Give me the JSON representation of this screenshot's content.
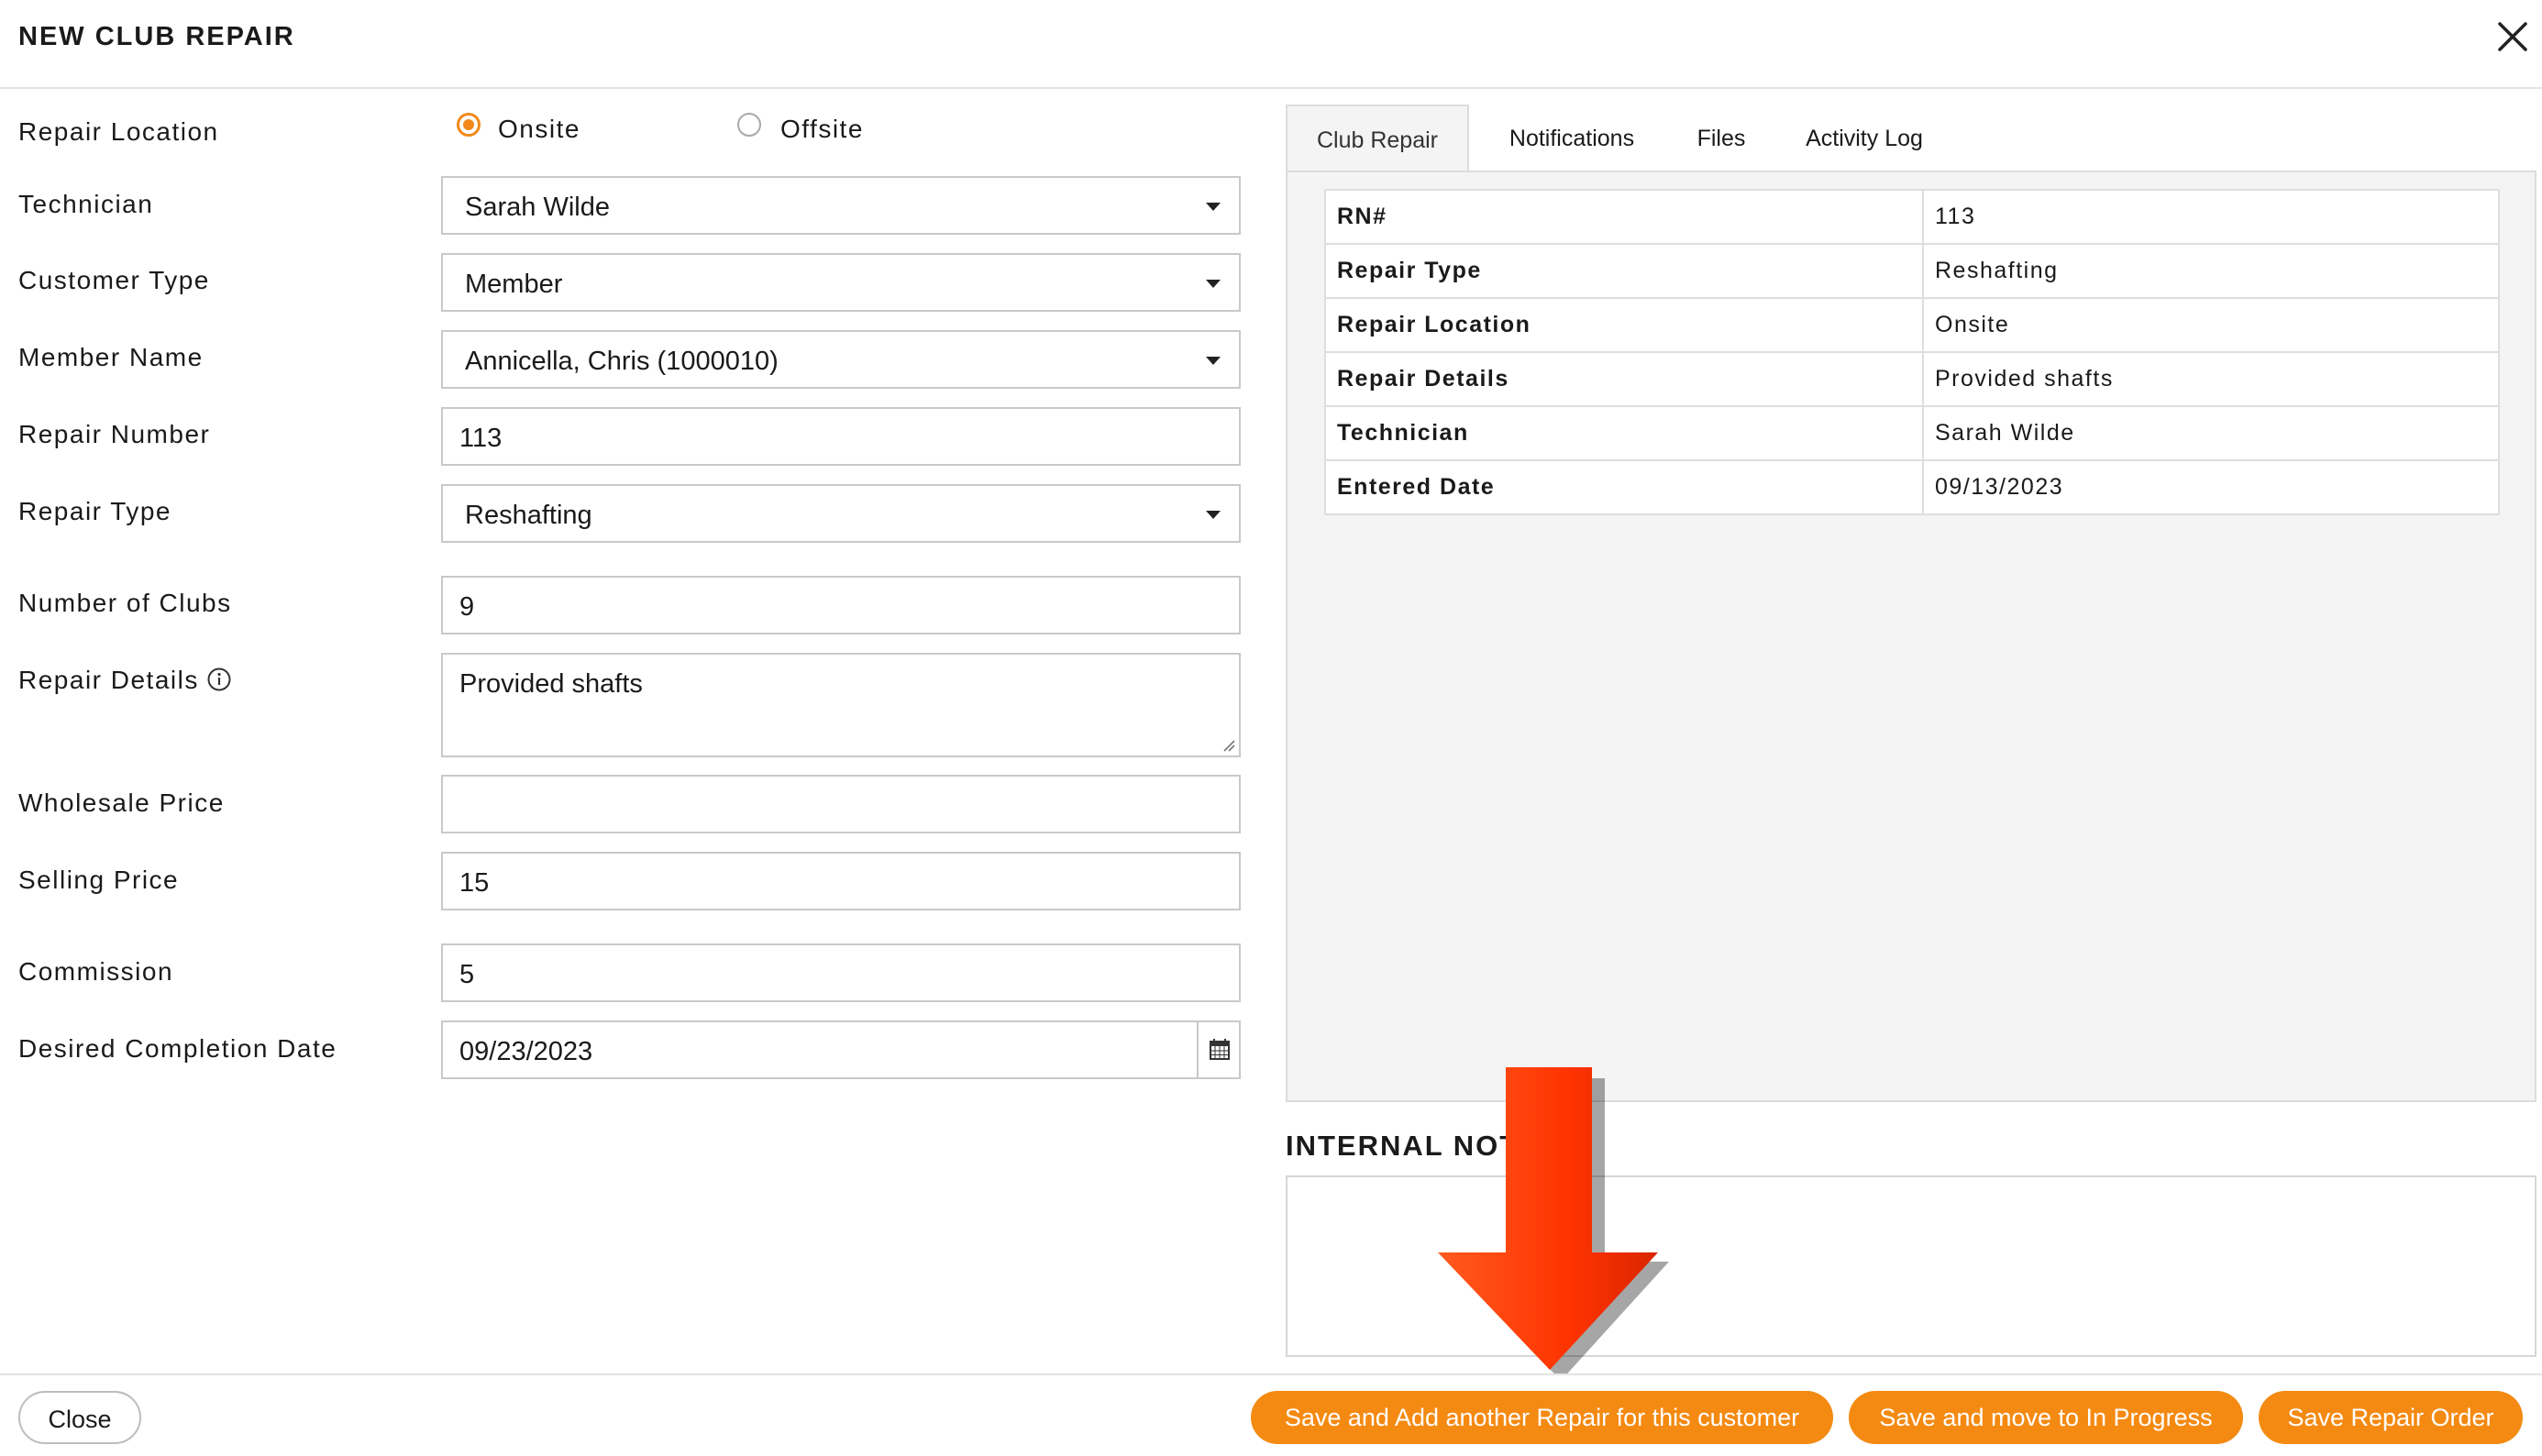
{
  "header": {
    "title": "NEW CLUB REPAIR",
    "close_icon": "close-icon"
  },
  "form": {
    "repair_location": {
      "label": "Repair Location",
      "options": [
        "Onsite",
        "Offsite"
      ],
      "selected": "Onsite"
    },
    "technician": {
      "label": "Technician",
      "value": "Sarah Wilde"
    },
    "customer_type": {
      "label": "Customer Type",
      "value": "Member"
    },
    "member_name": {
      "label": "Member Name",
      "value": "Annicella, Chris (1000010)"
    },
    "repair_number": {
      "label": "Repair Number",
      "value": "113"
    },
    "repair_type": {
      "label": "Repair Type",
      "value": "Reshafting"
    },
    "number_of_clubs": {
      "label": "Number of Clubs",
      "value": "9"
    },
    "repair_details": {
      "label": "Repair Details",
      "value": "Provided shafts",
      "icon": "info-icon"
    },
    "wholesale_price": {
      "label": "Wholesale Price",
      "value": ""
    },
    "selling_price": {
      "label": "Selling Price",
      "value": "15"
    },
    "commission": {
      "label": "Commission",
      "value": "5"
    },
    "desired_completion_date": {
      "label": "Desired Completion Date",
      "value": "09/23/2023",
      "icon": "calendar-icon"
    }
  },
  "tabs": [
    {
      "label": "Club Repair",
      "active": true
    },
    {
      "label": "Notifications",
      "active": false
    },
    {
      "label": "Files",
      "active": false
    },
    {
      "label": "Activity Log",
      "active": false
    }
  ],
  "summary": [
    {
      "key": "RN#",
      "value": "113"
    },
    {
      "key": "Repair Type",
      "value": "Reshafting"
    },
    {
      "key": "Repair Location",
      "value": "Onsite"
    },
    {
      "key": "Repair Details",
      "value": "Provided shafts"
    },
    {
      "key": "Technician",
      "value": "Sarah Wilde"
    },
    {
      "key": "Entered Date",
      "value": "09/13/2023"
    }
  ],
  "internal_notes": {
    "title": "INTERNAL NOT",
    "value": ""
  },
  "footer": {
    "close_label": "Close",
    "save_add_label": "Save and Add another Repair for this customer",
    "save_progress_label": "Save and move to In Progress",
    "save_order_label": "Save Repair Order"
  },
  "colors": {
    "accent": "#f48a12",
    "arrow": "#ff3300",
    "panel_bg": "#f4f4f4"
  }
}
